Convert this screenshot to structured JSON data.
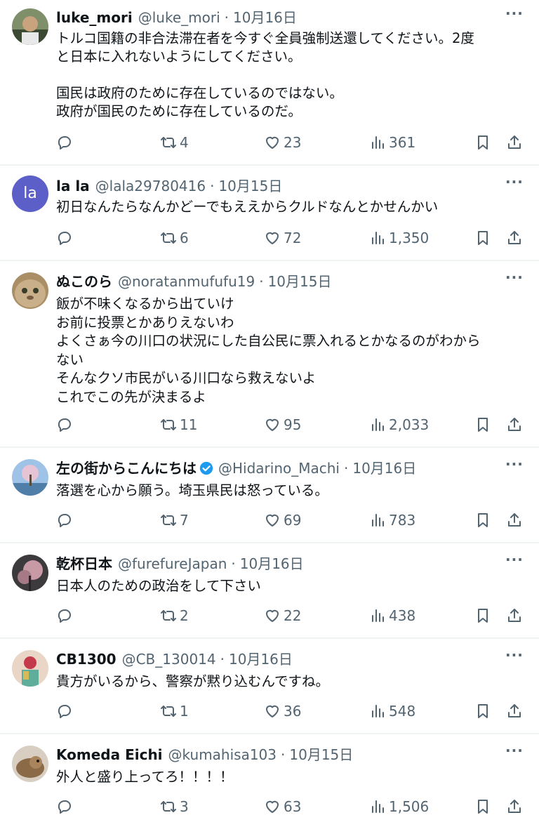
{
  "tweets": [
    {
      "name": "luke_mori",
      "handle": "@luke_mori",
      "date": "10月16日",
      "verified": false,
      "avatar": "photo",
      "text": "トルコ国籍の非合法滞在者を今すぐ全員強制送還してください。2度\nと日本に入れないようにしてください。\n\n国民は政府のために存在しているのではない。\n政府が国民のために存在しているのだ。",
      "retweets": "4",
      "likes": "23",
      "views": "361"
    },
    {
      "name": "la la",
      "handle": "@lala29780416",
      "date": "10月15日",
      "verified": false,
      "avatar": "initials",
      "avatar_text": "la",
      "text": "初日なんたらなんかどーでもええからクルドなんとかせんかい",
      "retweets": "6",
      "likes": "72",
      "views": "1,350"
    },
    {
      "name": "ぬこのら",
      "handle": "@noratanmufufu19",
      "date": "10月15日",
      "verified": false,
      "avatar": "photo",
      "text": "飯が不味くなるから出ていけ\nお前に投票とかありえないわ\nよくさぁ今の川口の状況にした自公民に票入れるとかなるのがわから\nない\nそんなクソ市民がいる川口なら救えないよ\nこれでこの先が決まるよ",
      "retweets": "11",
      "likes": "95",
      "views": "2,033"
    },
    {
      "name": "左の街からこんにちは",
      "handle": "@Hidarino_Machi",
      "date": "10月16日",
      "verified": true,
      "avatar": "photo",
      "text": "落選を心から願う。埼玉県民は怒っている。",
      "retweets": "7",
      "likes": "69",
      "views": "783"
    },
    {
      "name": "乾杯日本",
      "handle": "@furefureJapan",
      "date": "10月16日",
      "verified": false,
      "avatar": "photo",
      "text": "日本人のための政治をして下さい",
      "retweets": "2",
      "likes": "22",
      "views": "438"
    },
    {
      "name": "CB1300",
      "handle": "@CB_130014",
      "date": "10月16日",
      "verified": false,
      "avatar": "photo",
      "text": "貴方がいるから、警察が黙り込むんですね。",
      "retweets": "1",
      "likes": "36",
      "views": "548"
    },
    {
      "name": "Komeda Eichi",
      "handle": "@kumahisa103",
      "date": "10月15日",
      "verified": false,
      "avatar": "photo",
      "text": "外人と盛り上ってろ！！！！",
      "retweets": "3",
      "likes": "63",
      "views": "1,506"
    }
  ],
  "separator": "·",
  "colors": {
    "text": "#0f1419",
    "muted": "#536471",
    "divider": "#eff3f4",
    "verified": "#1d9bf0",
    "initials_avatar": "#5b5fc7"
  }
}
